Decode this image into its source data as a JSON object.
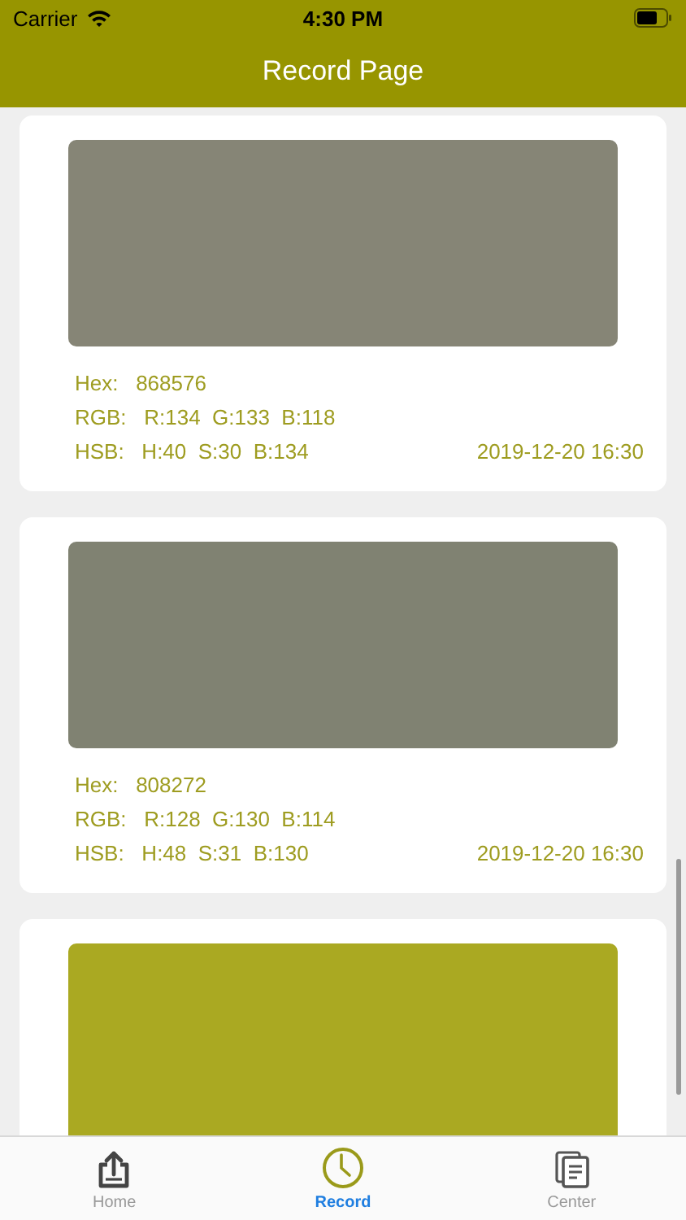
{
  "status_bar": {
    "carrier": "Carrier",
    "time": "4:30 PM"
  },
  "nav_bar": {
    "title": "Record Page"
  },
  "records": [
    {
      "color": "#868576",
      "hex": "Hex:   868576",
      "rgb": "RGB:   R:134  G:133  B:118",
      "hsb": "HSB:   H:40  S:30  B:134",
      "date": "2019-12-20 16:30"
    },
    {
      "color": "#808272",
      "hex": "Hex:   808272",
      "rgb": "RGB:   R:128  G:130  B:114",
      "hsb": "HSB:   H:48  S:31  B:130",
      "date": "2019-12-20 16:30"
    },
    {
      "color": "#aaa922"
    }
  ],
  "tab_bar": [
    {
      "kind": "upload",
      "label": "Home",
      "selected": false
    },
    {
      "kind": "clock",
      "label": "Record",
      "selected": true
    },
    {
      "kind": "documents",
      "label": "Center",
      "selected": false
    }
  ]
}
